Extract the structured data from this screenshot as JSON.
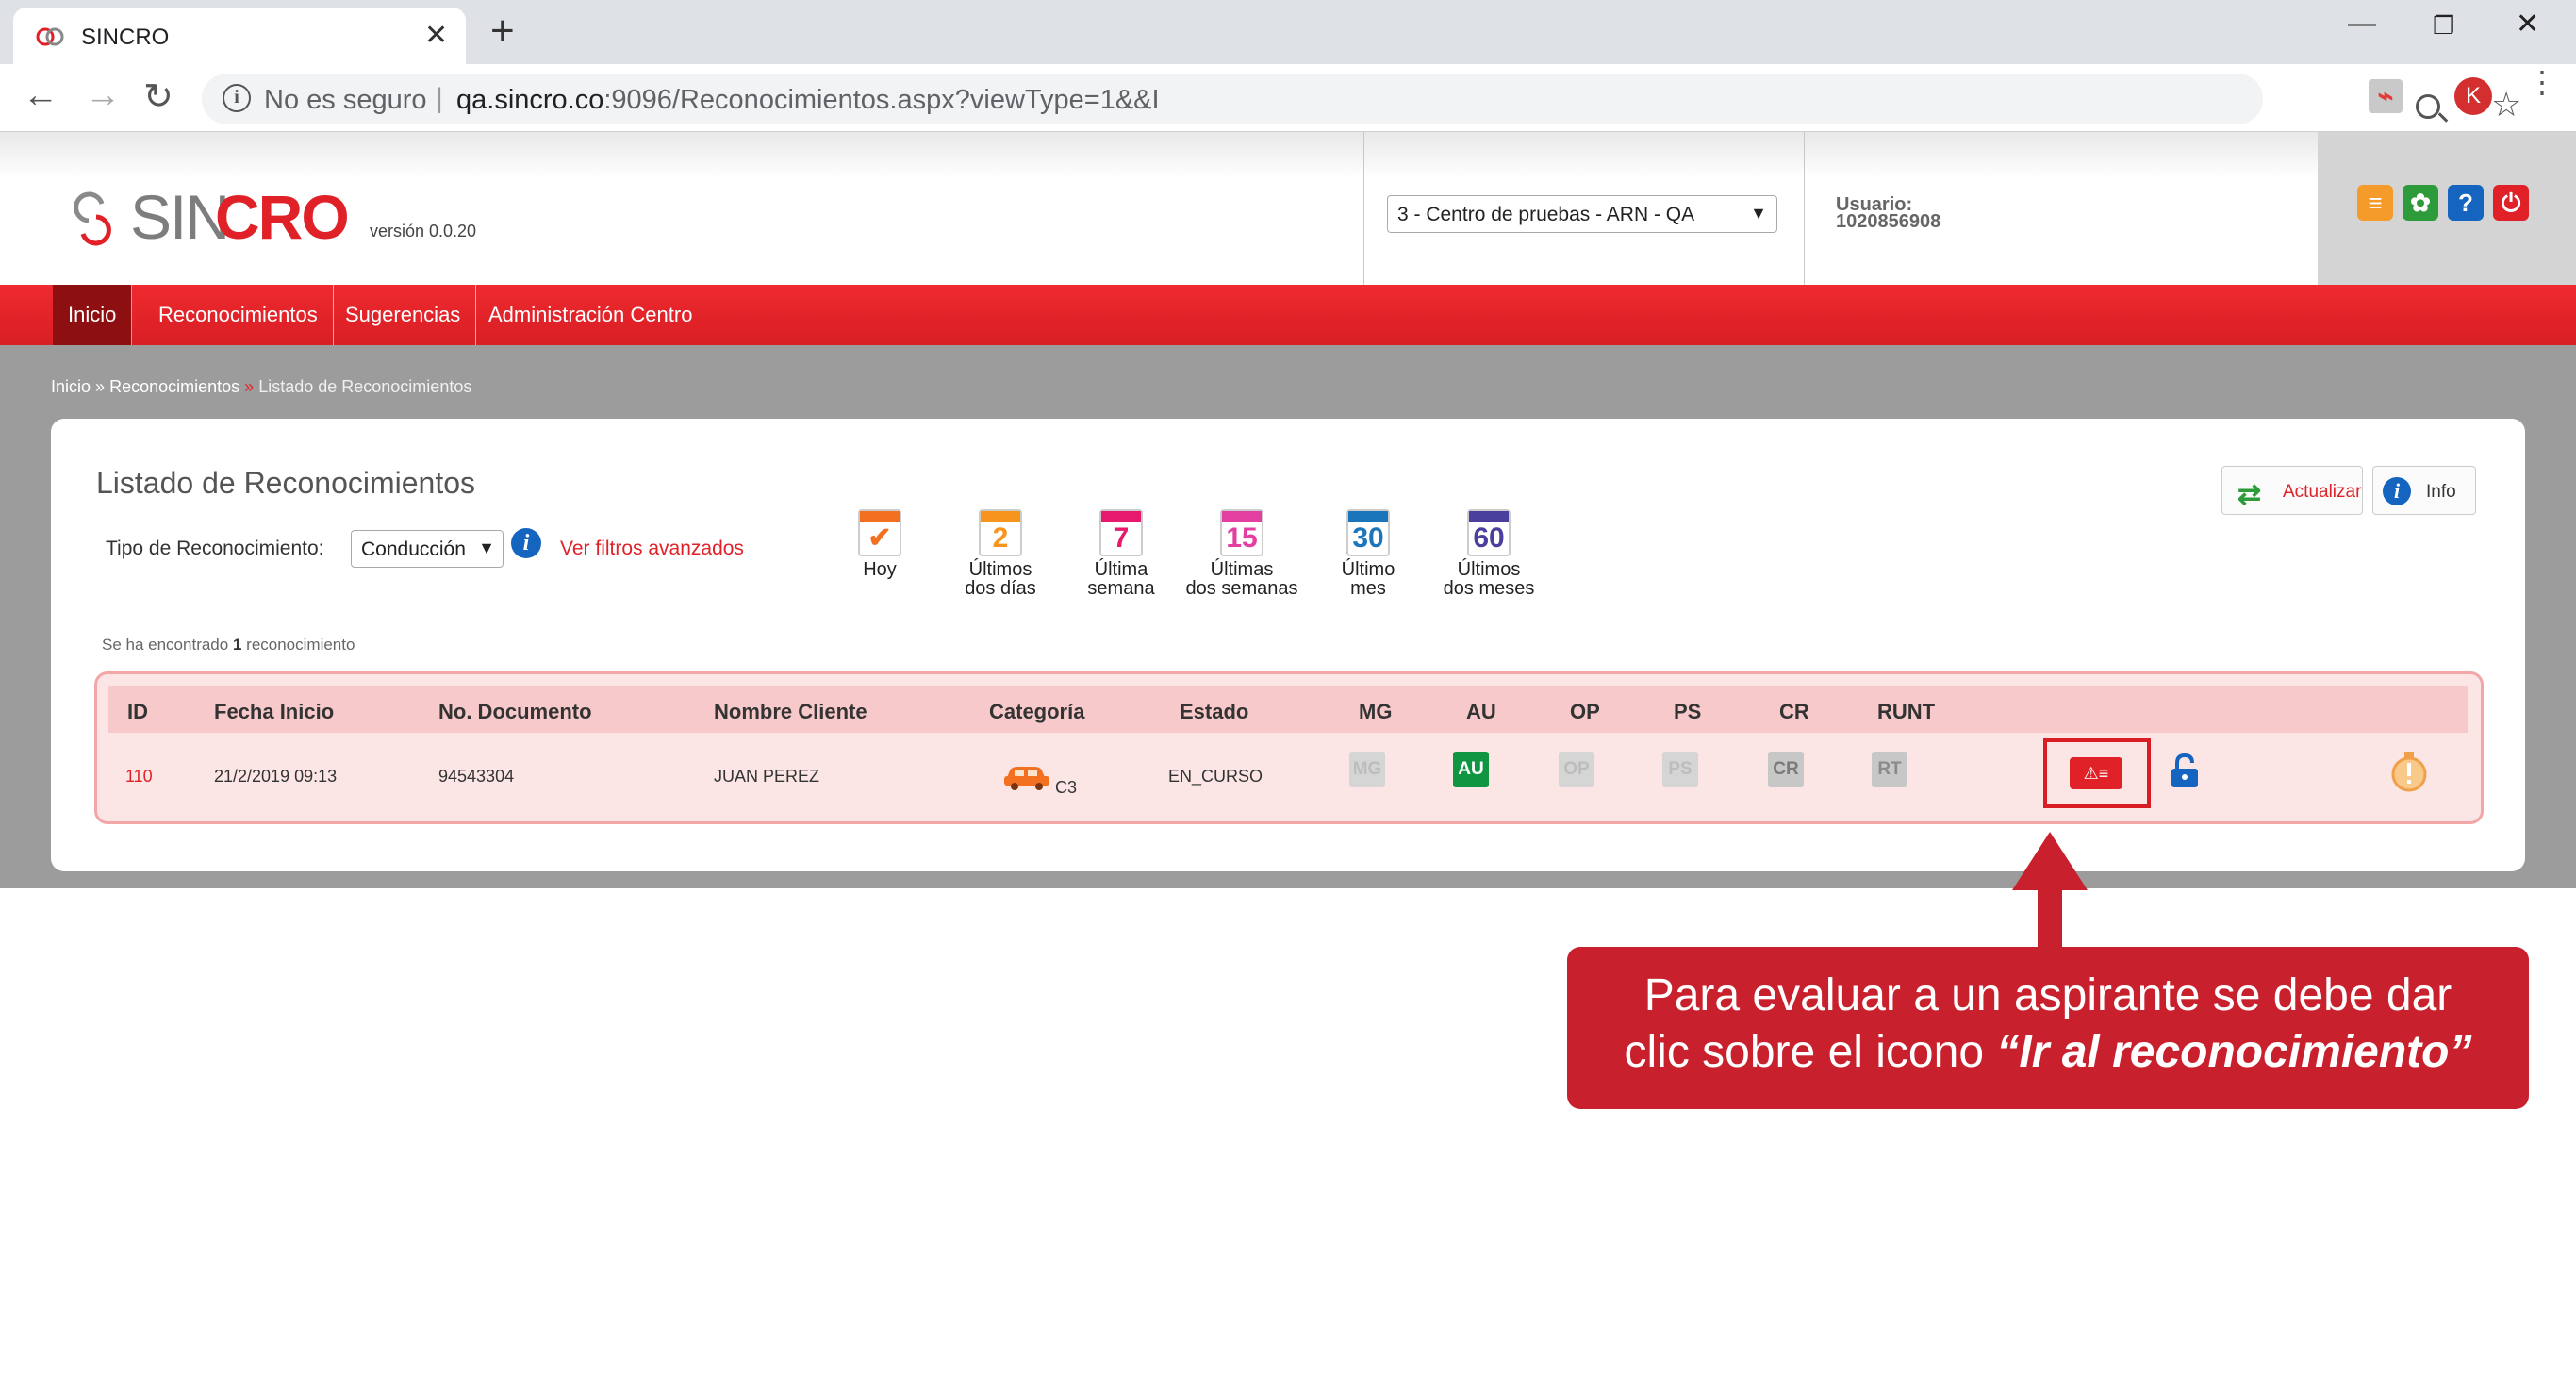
{
  "browser": {
    "tab_title": "SINCRO",
    "tab_close": "✕",
    "new_tab": "+",
    "not_secure": "No es seguro",
    "url_host": "qa.sincro.co",
    "url_rest": ":9096/Reconocimientos.aspx?viewType=1&&I",
    "profile_initial": "K"
  },
  "header": {
    "logo_sin": "SIN",
    "logo_cro": "CRO",
    "version": "versión 0.0.20",
    "center_selected": "3 - Centro de pruebas - ARN - QA",
    "user_label": "Usuario:",
    "user_id": "1020856908"
  },
  "nav": {
    "items": [
      "Inicio",
      "Reconocimientos",
      "Sugerencias",
      "Administración Centro"
    ]
  },
  "breadcrumb": {
    "home": "Inicio",
    "section": "Reconocimientos",
    "current": "Listado de Reconocimientos",
    "sep": "»"
  },
  "page": {
    "title": "Listado de Reconocimientos",
    "tipo_label": "Tipo de Reconocimiento:",
    "tipo_value": "Conducción",
    "advanced_filters": "Ver filtros avanzados",
    "found_prefix": "Se ha encontrado",
    "found_count": "1",
    "found_suffix": "reconocimiento",
    "btn_actualizar": "Actualizar",
    "btn_info": "Info"
  },
  "date_filters": [
    {
      "num": "",
      "label1": "Hoy",
      "label2": "",
      "color": "#f37021"
    },
    {
      "num": "2",
      "label1": "Últimos",
      "label2": "dos días",
      "color": "#f7941d"
    },
    {
      "num": "7",
      "label1": "Última",
      "label2": "semana",
      "color": "#e6196c"
    },
    {
      "num": "15",
      "label1": "Últimas",
      "label2": "dos semanas",
      "color": "#e23fa0"
    },
    {
      "num": "30",
      "label1": "Último",
      "label2": "mes",
      "color": "#1b75bb"
    },
    {
      "num": "60",
      "label1": "Últimos",
      "label2": "dos meses",
      "color": "#4a3f9c"
    }
  ],
  "table": {
    "headers": [
      "ID",
      "Fecha Inicio",
      "No. Documento",
      "Nombre Cliente",
      "Categoría",
      "Estado",
      "MG",
      "AU",
      "OP",
      "PS",
      "CR",
      "RUNT"
    ],
    "row": {
      "id": "110",
      "fecha": "21/2/2019 09:13",
      "documento": "94543304",
      "cliente": "JUAN PEREZ",
      "categoria": "C3",
      "estado": "EN_CURSO",
      "status_badges": [
        {
          "label": "MG",
          "color": "#d5d5d5",
          "text_color": "#bdbdbd"
        },
        {
          "label": "AU",
          "color": "#109642",
          "text_color": "#ffffff"
        },
        {
          "label": "OP",
          "color": "#d5d5d5",
          "text_color": "#bdbdbd"
        },
        {
          "label": "PS",
          "color": "#d5d5d5",
          "text_color": "#bdbdbd"
        },
        {
          "label": "CR",
          "color": "#c7c7c7",
          "text_color": "#7a7a7a"
        },
        {
          "label": "RT",
          "color": "#c7c7c7",
          "text_color": "#8a8a8a"
        }
      ]
    }
  },
  "callout": {
    "line1": "Para evaluar a un aspirante se debe dar",
    "line2_prefix": "clic sobre el icono ",
    "line2_emph": "“Ir al reconocimiento”"
  },
  "colors": {
    "brand_red": "#e02228",
    "nav_active": "#8d0f12",
    "callout": "#c8202c"
  },
  "icons": {
    "favicon": "sincro-logo-icon",
    "info": "info-icon",
    "star": "star-icon",
    "zoom": "zoom-icon",
    "lock": "lock-icon",
    "alert": "alert-icon",
    "car": "car-icon",
    "go": "go-to-recognition-icon"
  }
}
